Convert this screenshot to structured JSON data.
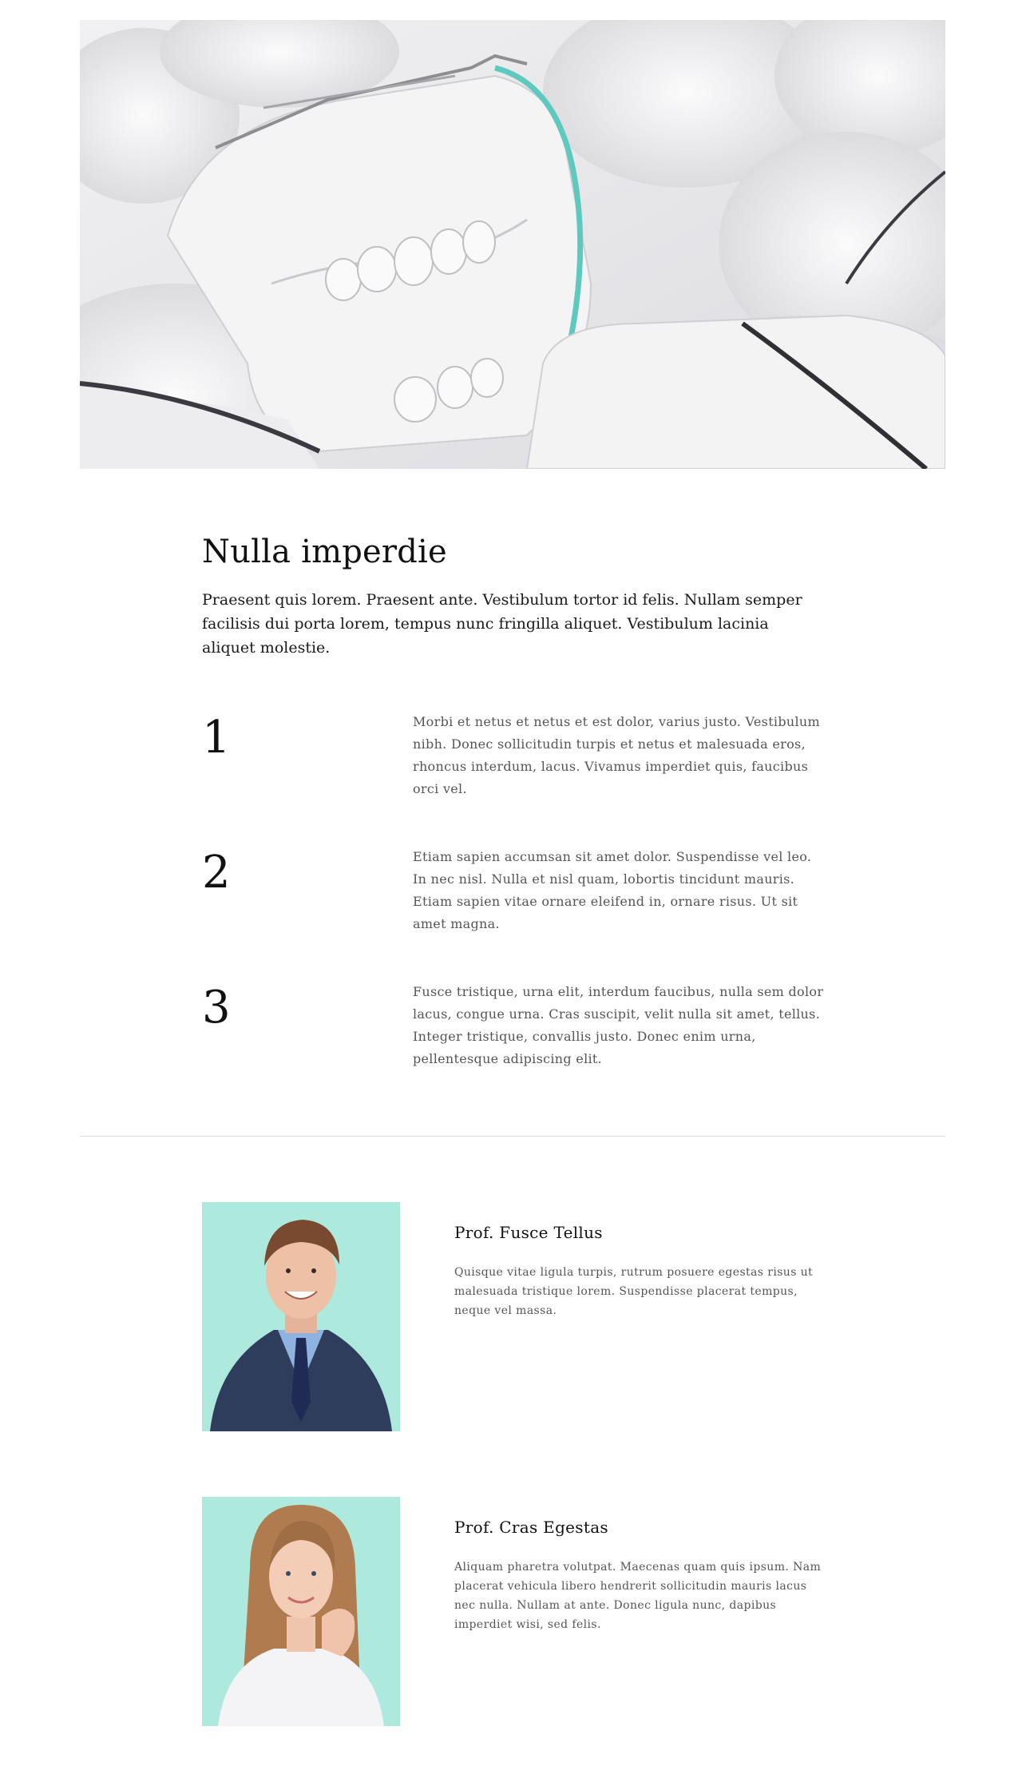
{
  "hero": {
    "image": "dental-plaster-casts-photo"
  },
  "intro": {
    "title": "Nulla imperdie",
    "lead": "Praesent quis lorem. Praesent ante. Vestibulum tortor id felis. Nullam semper facilisis dui porta lorem, tempus nunc fringilla aliquet. Vestibulum lacinia aliquet molestie."
  },
  "steps": [
    {
      "number": "1",
      "text": "Morbi et netus et netus et est dolor, varius justo. Vestibulum nibh. Donec sollicitudin turpis et netus et malesuada eros, rhoncus interdum, lacus. Vivamus imperdiet quis, faucibus orci vel."
    },
    {
      "number": "2",
      "text": "Etiam sapien accumsan sit amet dolor. Suspendisse vel leo. In nec nisl. Nulla et nisl quam, lobortis tincidunt mauris. Etiam sapien vitae ornare eleifend in, ornare risus. Ut sit amet magna."
    },
    {
      "number": "3",
      "text": "Fusce tristique, urna elit, interdum faucibus, nulla sem dolor lacus, congue urna. Cras suscipit, velit nulla sit amet, tellus. Integer tristique, convallis justo. Donec enim urna, pellentesque adipiscing elit."
    }
  ],
  "team": [
    {
      "name": "Prof. Fusce Tellus",
      "bio": "Quisque vitae ligula turpis, rutrum posuere egestas risus ut malesuada tristique lorem. Suspendisse placerat tempus, neque vel massa.",
      "photo": "portrait-man-suit"
    },
    {
      "name": "Prof. Cras Egestas",
      "bio": "Aliquam pharetra volutpat. Maecenas quam quis ipsum. Nam placerat vehicula libero hendrerit sollicitudin mauris lacus nec nulla. Nullam at ante. Donec ligula nunc, dapibus imperdiet wisi, sed felis.",
      "photo": "portrait-woman-long-hair"
    }
  ],
  "colors": {
    "photo_background": "#aee9dd",
    "divider": "#dcdcdc",
    "body_text": "#555555",
    "heading": "#111111"
  }
}
